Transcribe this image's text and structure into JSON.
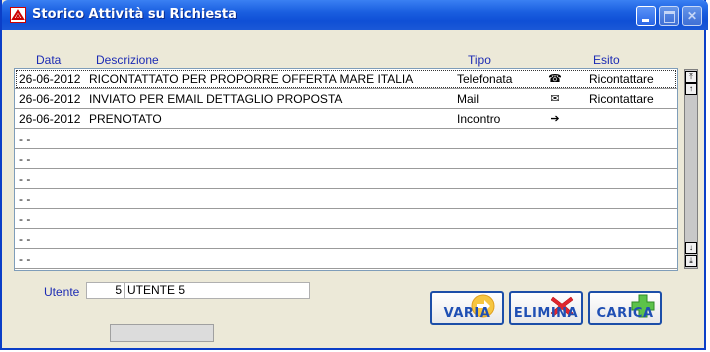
{
  "window": {
    "title": "Storico Attività su Richiesta"
  },
  "columns": {
    "data": "Data",
    "descrizione": "Descrizione",
    "tipo": "Tipo",
    "esito": "Esito"
  },
  "rows": [
    {
      "data": "26-06-2012",
      "descrizione": "RICONTATTATO PER PROPORRE OFFERTA MARE ITALIA",
      "tipo": "Telefonata",
      "icon": "☎",
      "icon_name": "telephone-icon",
      "esito": "Ricontattare"
    },
    {
      "data": "26-06-2012",
      "descrizione": "INVIATO PER EMAIL DETTAGLIO PROPOSTA",
      "tipo": "Mail",
      "icon": "✉",
      "icon_name": "envelope-icon",
      "esito": "Ricontattare"
    },
    {
      "data": "26-06-2012",
      "descrizione": "PRENOTATO",
      "tipo": "Incontro",
      "icon": "➔",
      "icon_name": "arrow-right-icon",
      "esito": ""
    },
    {
      "data": " - -",
      "descrizione": "",
      "tipo": "",
      "icon": "",
      "icon_name": "",
      "esito": ""
    },
    {
      "data": " - -",
      "descrizione": "",
      "tipo": "",
      "icon": "",
      "icon_name": "",
      "esito": ""
    },
    {
      "data": " - -",
      "descrizione": "",
      "tipo": "",
      "icon": "",
      "icon_name": "",
      "esito": ""
    },
    {
      "data": " - -",
      "descrizione": "",
      "tipo": "",
      "icon": "",
      "icon_name": "",
      "esito": ""
    },
    {
      "data": " - -",
      "descrizione": "",
      "tipo": "",
      "icon": "",
      "icon_name": "",
      "esito": ""
    },
    {
      "data": " - -",
      "descrizione": "",
      "tipo": "",
      "icon": "",
      "icon_name": "",
      "esito": ""
    },
    {
      "data": " - -",
      "descrizione": "",
      "tipo": "",
      "icon": "",
      "icon_name": "",
      "esito": ""
    }
  ],
  "utente": {
    "label": "Utente",
    "id": "5",
    "name": "UTENTE 5"
  },
  "buttons": {
    "varia": "VARIA",
    "elimina": "ELIMINA",
    "carica": "CARICA"
  },
  "colors": {
    "titlebar": "#0f4fd6",
    "label_blue": "#1c2bb4",
    "button_text": "#1f4fb4"
  }
}
